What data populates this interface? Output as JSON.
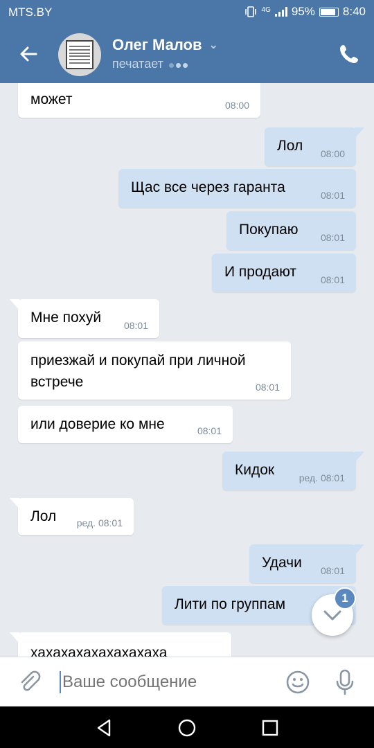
{
  "status": {
    "carrier": "MTS.BY",
    "net": "4G",
    "battery": "95%",
    "time": "8:40"
  },
  "header": {
    "name": "Олег Малов",
    "status": "печатает"
  },
  "messages": [
    {
      "text": "может",
      "time": "08:00",
      "dir": "in"
    },
    {
      "text": "Лол",
      "time": "08:00",
      "dir": "out"
    },
    {
      "text": "Щас все через гаранта",
      "time": "08:01",
      "dir": "out"
    },
    {
      "text": "Покупаю",
      "time": "08:01",
      "dir": "out"
    },
    {
      "text": "И продают",
      "time": "08:01",
      "dir": "out"
    },
    {
      "text": "Мне похуй",
      "time": "08:01",
      "dir": "in"
    },
    {
      "text": "приезжай и покупай при личной встрече",
      "time": "08:01",
      "dir": "in"
    },
    {
      "text": "или доверие ко мне",
      "time": "08:01",
      "dir": "in"
    },
    {
      "text": "Кидок",
      "time": "ред. 08:01",
      "dir": "out"
    },
    {
      "text": "Лол",
      "time": "ред. 08:01",
      "dir": "in"
    },
    {
      "text": "Удачи",
      "time": "08:01",
      "dir": "out"
    },
    {
      "text": "Лити  по группам",
      "time": "",
      "dir": "out"
    },
    {
      "text": "хахахахахахахахаха",
      "time": "",
      "dir": "in"
    }
  ],
  "unread_badge": "1",
  "composer": {
    "placeholder": "Ваше сообщение"
  }
}
